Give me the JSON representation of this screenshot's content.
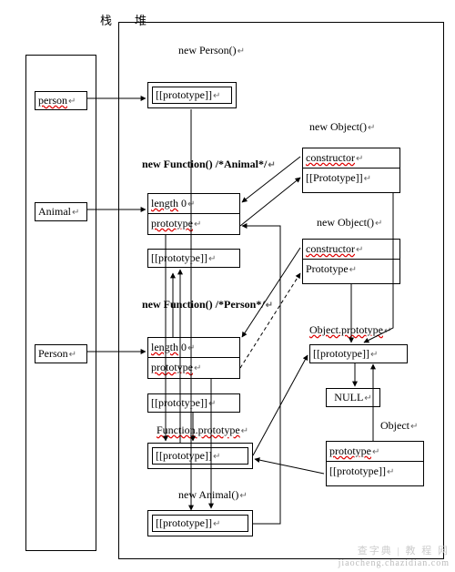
{
  "labels": {
    "stack": "栈",
    "heap": "堆"
  },
  "stack": {
    "person_var": "person",
    "animal_var": "Animal",
    "person_ctor": "Person"
  },
  "heap": {
    "new_person": "new Person()",
    "proto_slot": "[[prototype]]",
    "proto_slot_cap": "[[Prototype]]",
    "new_func_animal": "new Function() /*Animal*/",
    "new_func_person": "new Function() /*Person*/",
    "length0a": "length",
    "length0b": "0",
    "prototype_word": "prototype",
    "proto_cap": "Prototype",
    "function_prototype": "Function.prototype",
    "object_prototype": "Object.prototype",
    "new_animal": "new Animal()",
    "new_object": "new Object()",
    "constructor_word": "constructor",
    "null_word": "NULL",
    "object_word": "Object"
  },
  "watermark": {
    "l1": "查字典 | 教 程 网",
    "l2": "jiaocheng.chazidian.com"
  }
}
